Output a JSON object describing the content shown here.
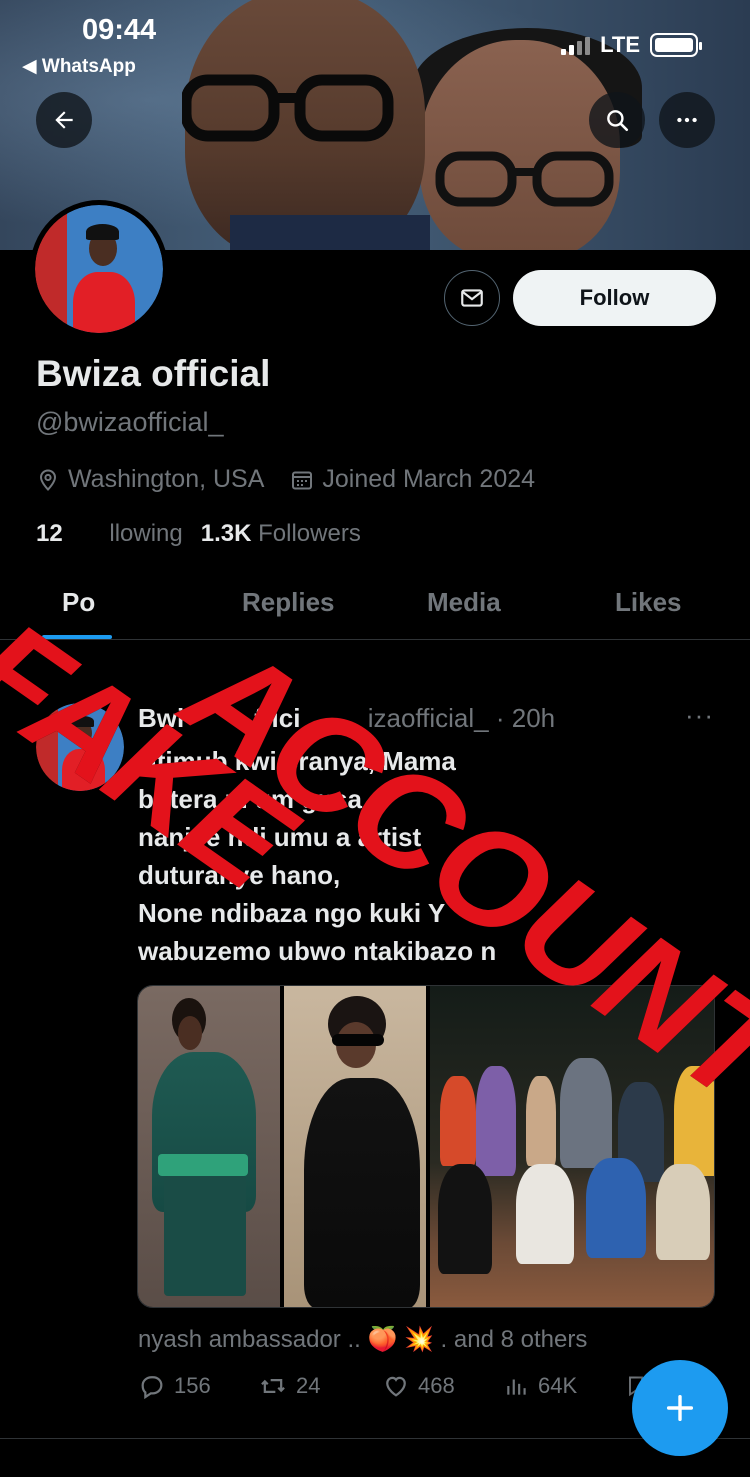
{
  "status_bar": {
    "time": "09:44",
    "back_app": "◀ WhatsApp",
    "network": "LTE"
  },
  "profile": {
    "display_name": "Bwiza official",
    "handle": "@bwizaofficial_",
    "location": "Washington, USA",
    "joined": "Joined March 2024",
    "following_count": "12",
    "following_label": "llowing",
    "followers_count": "1.3K",
    "followers_label": "Followers",
    "follow_label": "Follow"
  },
  "tabs": {
    "posts": "Po",
    "replies": "Replies",
    "media": "Media",
    "likes": "Likes"
  },
  "post": {
    "author": "Bwi",
    "author_tail": "ffici",
    "handle": "izaofficial_",
    "time": "· 20h",
    "more": "···",
    "lines": [
      "Ntimub          kwi   eranya, Mama",
      "butera ni um              gusa",
      "nanjye ndi umu a             artist",
      "duturanye hano,",
      "None ndibaza ngo kuki Y",
      "wabuzemo ubwo ntakibazo n"
    ],
    "liked_by": "nyash ambassador .. 🍑 💥 . and 8 others",
    "replies": "156",
    "reposts": "24",
    "likes": "468",
    "views": "64K"
  },
  "overlay": {
    "line1": "FAKE",
    "line2": "ACCOUNT",
    "color": "#e3121b"
  },
  "colors": {
    "accent": "#1d9bf0",
    "text_primary": "#e7e9ea",
    "text_secondary": "#71767b",
    "background": "#000000"
  }
}
